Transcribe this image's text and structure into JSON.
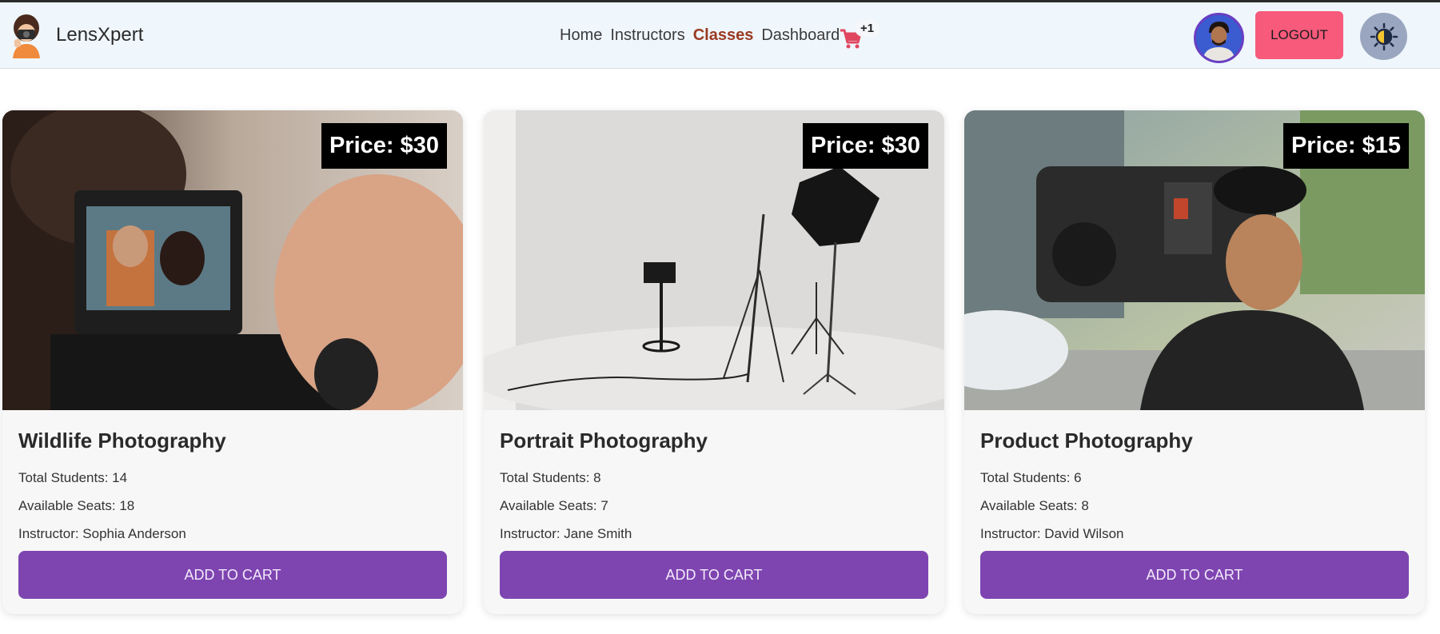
{
  "app": {
    "brand_name": "LensXpert"
  },
  "nav": {
    "items": [
      {
        "label": "Home",
        "active": false
      },
      {
        "label": "Instructors",
        "active": false
      },
      {
        "label": "Classes",
        "active": true
      },
      {
        "label": "Dashboard",
        "active": false
      }
    ],
    "cart_count": "+1",
    "logout_label": "LOGOUT"
  },
  "icons": {
    "logo": "photographer-logo-icon",
    "cart": "cart-icon",
    "avatar": "user-avatar",
    "theme": "sun-theme-icon"
  },
  "colors": {
    "accent_purple": "#7e45b1",
    "logout_pink": "#f75a7b",
    "active_nav": "#9a3a22",
    "navbar_bg": "#eff6fc"
  },
  "classes": [
    {
      "price_label": "Price: $30",
      "title": "Wildlife Photography",
      "total_students": "Total Students: 14",
      "available_seats": "Available Seats: 18",
      "instructor": "Instructor: Sophia Anderson",
      "button_label": "ADD TO CART"
    },
    {
      "price_label": "Price: $30",
      "title": "Portrait Photography",
      "total_students": "Total Students: 8",
      "available_seats": "Available Seats: 7",
      "instructor": "Instructor: Jane Smith",
      "button_label": "ADD TO CART"
    },
    {
      "price_label": "Price: $15",
      "title": "Product Photography",
      "total_students": "Total Students: 6",
      "available_seats": "Available Seats: 8",
      "instructor": "Instructor: David Wilson",
      "button_label": "ADD TO CART"
    }
  ]
}
